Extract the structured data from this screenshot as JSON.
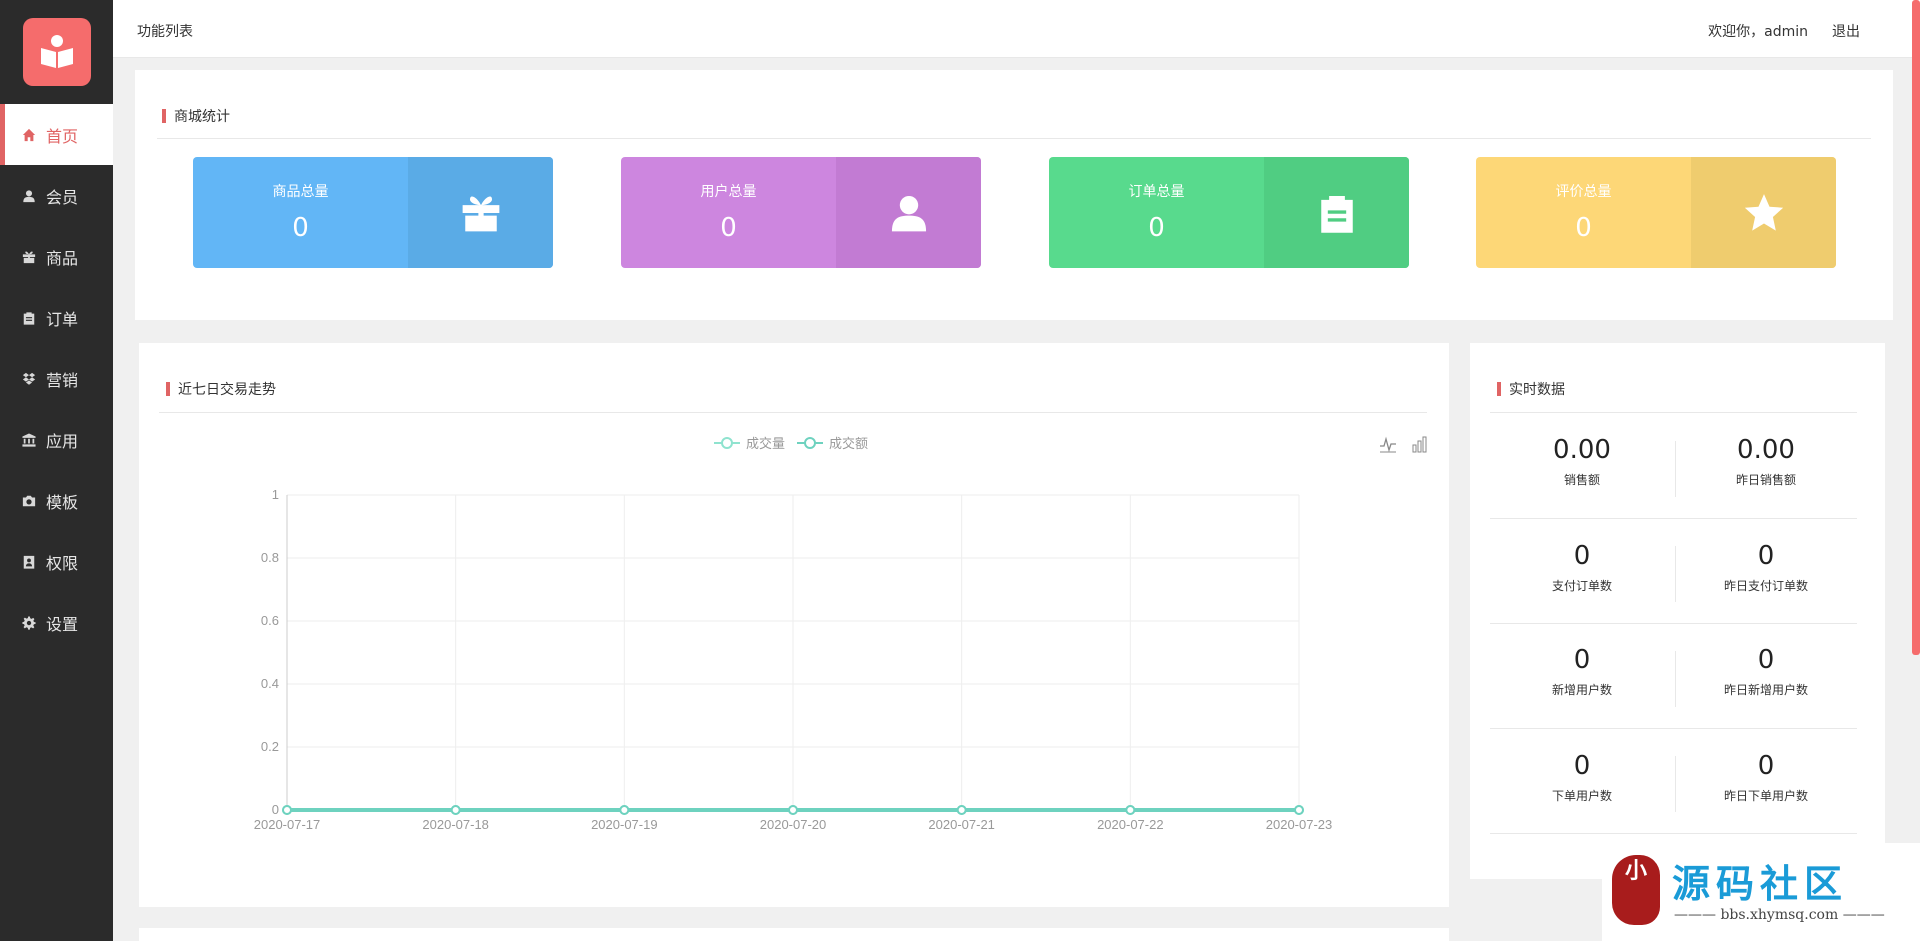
{
  "sidebar": {
    "items": [
      {
        "label": "首页",
        "icon": "home-icon"
      },
      {
        "label": "会员",
        "icon": "user-icon"
      },
      {
        "label": "商品",
        "icon": "gift-icon"
      },
      {
        "label": "订单",
        "icon": "clipboard-icon"
      },
      {
        "label": "营销",
        "icon": "dropbox-icon"
      },
      {
        "label": "应用",
        "icon": "bank-icon"
      },
      {
        "label": "模板",
        "icon": "camera-icon"
      },
      {
        "label": "权限",
        "icon": "id-badge-icon"
      },
      {
        "label": "设置",
        "icon": "gear-icon"
      }
    ],
    "active": 0,
    "accent": "#e06464"
  },
  "header": {
    "crumb": "功能列表",
    "welcome": "欢迎你，admin",
    "logout": "退出"
  },
  "stats": {
    "title": "商城统计",
    "cards": [
      {
        "label": "商品总量",
        "value": "0",
        "icon": "gift-icon",
        "color": "#62b6f6",
        "icon_bg": "#5aabe6"
      },
      {
        "label": "用户总量",
        "value": "0",
        "icon": "user-icon",
        "color": "#cd86df",
        "icon_bg": "#c27bd3"
      },
      {
        "label": "订单总量",
        "value": "0",
        "icon": "clipboard-icon",
        "color": "#58da8d",
        "icon_bg": "#50cd82"
      },
      {
        "label": "评价总量",
        "value": "0",
        "icon": "star-icon",
        "color": "#fdd777",
        "icon_bg": "#efcc6e"
      }
    ]
  },
  "trend": {
    "title": "近七日交易走势"
  },
  "chart_data": {
    "type": "line",
    "x": [
      "2020-07-17",
      "2020-07-18",
      "2020-07-19",
      "2020-07-20",
      "2020-07-21",
      "2020-07-22",
      "2020-07-23"
    ],
    "series": [
      {
        "name": "成交量",
        "values": [
          0,
          0,
          0,
          0,
          0,
          0,
          0
        ],
        "color": "#8fe3cf"
      },
      {
        "name": "成交额",
        "values": [
          0,
          0,
          0,
          0,
          0,
          0,
          0
        ],
        "color": "#6ed2bf"
      }
    ],
    "yticks": [
      "0",
      "0.2",
      "0.4",
      "0.6",
      "0.8",
      "1"
    ],
    "ylim": [
      0,
      1
    ],
    "grid": true,
    "legend": "top-center"
  },
  "realtime": {
    "title": "实时数据",
    "cells": [
      {
        "value": "0.00",
        "label": "销售额"
      },
      {
        "value": "0.00",
        "label": "昨日销售额"
      },
      {
        "value": "0",
        "label": "支付订单数"
      },
      {
        "value": "0",
        "label": "昨日支付订单数"
      },
      {
        "value": "0",
        "label": "新增用户数"
      },
      {
        "value": "0",
        "label": "昨日新增用户数"
      },
      {
        "value": "0",
        "label": "下单用户数"
      },
      {
        "value": "0",
        "label": "昨日下单用户数"
      }
    ]
  },
  "watermark": {
    "seal": "小",
    "text": "源码社区",
    "url": "bbs.xhymsq.com"
  }
}
